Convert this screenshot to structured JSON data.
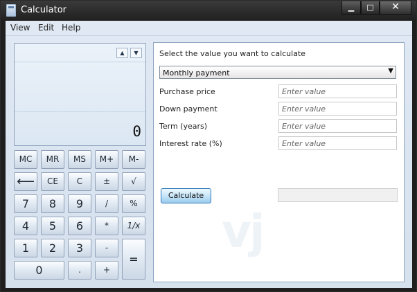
{
  "window": {
    "title": "Calculator",
    "min_glyph": "▁",
    "max_glyph": "□",
    "close_glyph": "✕"
  },
  "menu": [
    "View",
    "Edit",
    "Help"
  ],
  "display": {
    "value": "0",
    "history_up": "▲",
    "history_down": "▼"
  },
  "keys": {
    "memory": [
      "MC",
      "MR",
      "MS",
      "M+",
      "M-"
    ],
    "row2": [
      "⟵",
      "CE",
      "C",
      "±",
      "√"
    ],
    "row3": [
      "7",
      "8",
      "9",
      "/",
      "%"
    ],
    "row4": [
      "4",
      "5",
      "6",
      "*",
      "1/x"
    ],
    "row5": [
      "1",
      "2",
      "3",
      "-"
    ],
    "row6": [
      "0",
      ".",
      "+"
    ],
    "equals": "="
  },
  "worksheet": {
    "prompt": "Select the value you want to calculate",
    "selected_value": "Monthly payment",
    "labels": [
      "Purchase price",
      "Down payment",
      "Term (years)",
      "Interest rate (%)"
    ],
    "placeholders": [
      "Enter value",
      "Enter value",
      "Enter value",
      "Enter value"
    ],
    "calculate_label": "Calculate",
    "result_value": "",
    "watermark": "vj"
  }
}
